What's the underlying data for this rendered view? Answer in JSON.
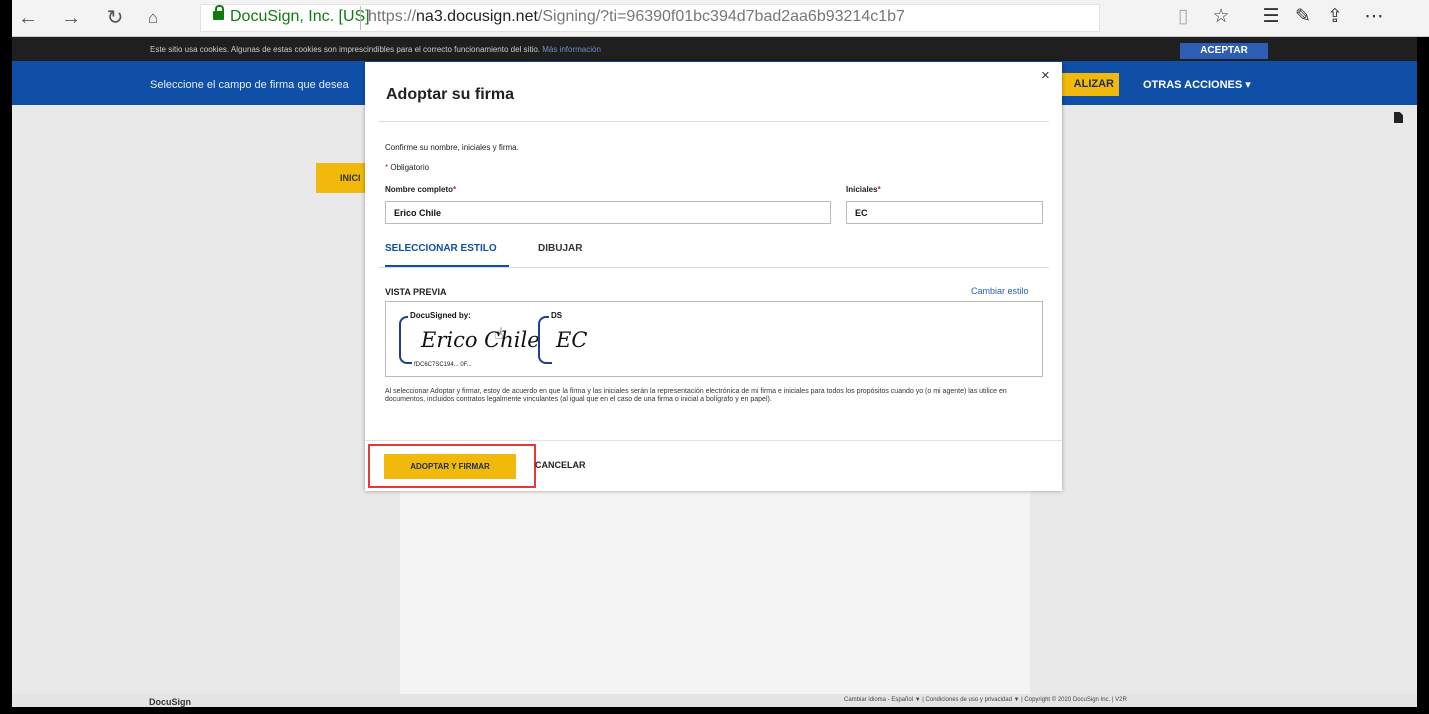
{
  "browser": {
    "site_identity": "DocuSign, Inc. [US]",
    "url_prefix": "https://",
    "url_host": "na3.docusign.net",
    "url_path": "/Signing/?ti=96390f01bc394d7bad2aa6b93214c1b7",
    "nav_icons": [
      "back-arrow-icon",
      "forward-arrow-icon",
      "refresh-icon",
      "home-icon"
    ],
    "toolbar_icons": [
      "reading-view-icon",
      "favorite-star-icon",
      "favorites-hub-icon",
      "pen-icon",
      "share-icon",
      "more-icon"
    ]
  },
  "cookie_bar": {
    "text": "Este sitio usa cookies. Algunas de estas cookies son imprescindibles para el correcto funcionamiento del sitio.",
    "link": "Más información",
    "accept_label": "ACEPTAR"
  },
  "action_bar": {
    "instruction": "Seleccione el campo de firma que desea",
    "finish_label": "ALIZAR",
    "other_actions_label": "OTRAS ACCIONES ▾"
  },
  "document": {
    "initial_tab_label": "INICI"
  },
  "modal": {
    "title": "Adoptar su firma",
    "close_label": "×",
    "confirm_text": "Confirme su nombre, iniciales y firma.",
    "required_note": "Obligatorio",
    "full_name_label": "Nombre completo",
    "full_name_value": "Erico Chile",
    "initials_label": "Iniciales",
    "initials_value": "EC",
    "tab_select_style": "SELECCIONAR ESTILO",
    "tab_draw": "DIBUJAR",
    "preview_label": "VISTA PREVIA",
    "change_style_label": "Cambiar estilo",
    "signature_header": "DocuSigned by:",
    "signature_script": "Erico Chile",
    "signature_id": "fDC6C7SC194... 0F...",
    "initials_header": "DS",
    "initials_script": "EC",
    "legal_text": "Al seleccionar Adoptar y firmar, estoy de acuerdo en que la firma y las iniciales serán la representación electrónica de mi firma e iniciales para todos los propósitos cuando yo (o mi agente) las utilice en documentos, incluidos contratos legalmente vinculantes (al igual que en el caso de una firma o inicial a bolígrafo y en papel).",
    "adopt_button_label": "ADOPTAR Y FIRMAR",
    "cancel_button_label": "CANCELAR"
  },
  "footer": {
    "brand": "DocuSign",
    "links": "Cambiar idioma - Español ▼  |  Condiciones de uso y privacidad ▼  |  Copyright © 2020 DocuSign Inc. | V2R"
  },
  "colors": {
    "docusign_blue": "#0f4fa8",
    "accent_yellow": "#f0b90b",
    "highlight_red": "#e53935",
    "lock_green": "#107c10"
  }
}
